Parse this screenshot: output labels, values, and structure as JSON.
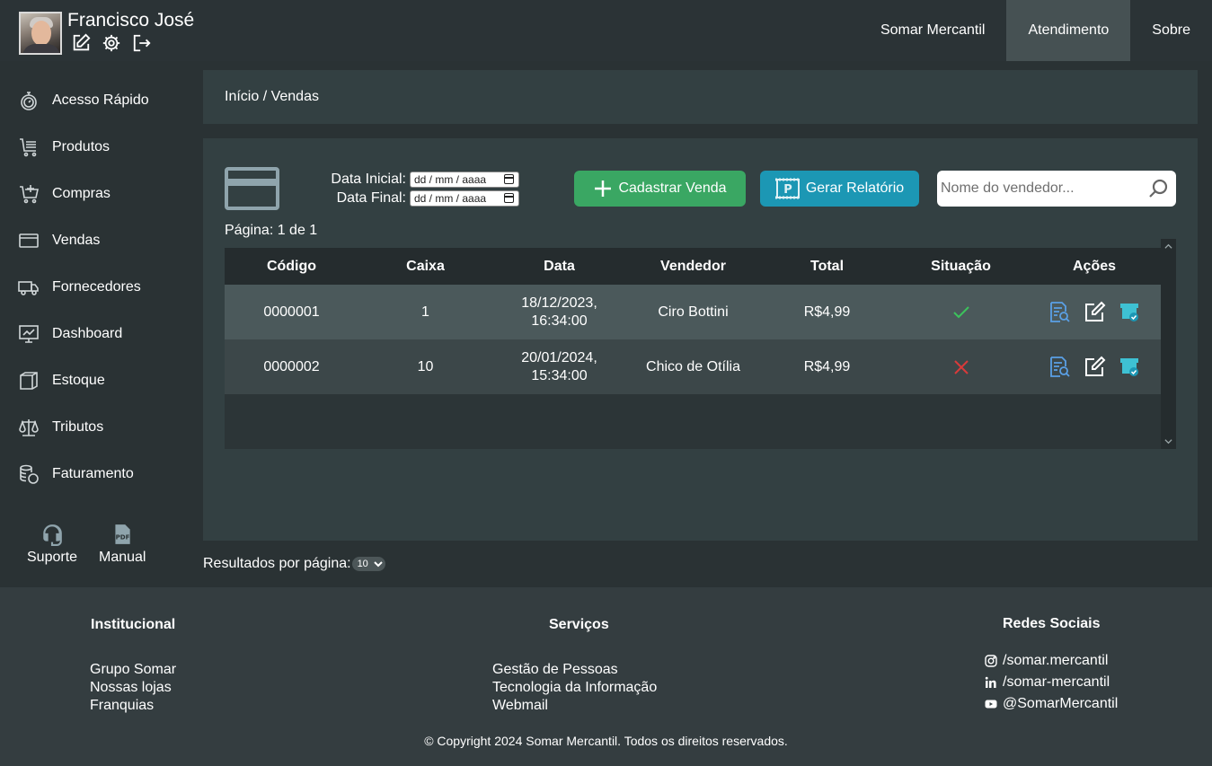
{
  "user": {
    "name": "Francisco José"
  },
  "nav": {
    "items": [
      "Somar Mercantil",
      "Atendimento",
      "Sobre"
    ],
    "active": "Atendimento"
  },
  "sidebar": {
    "items": [
      {
        "label": "Acesso Rápido",
        "icon": "stopwatch-icon"
      },
      {
        "label": "Produtos",
        "icon": "cart-list-icon"
      },
      {
        "label": "Compras",
        "icon": "cart-plus-icon"
      },
      {
        "label": "Vendas",
        "icon": "credit-card-icon"
      },
      {
        "label": "Fornecedores",
        "icon": "truck-icon"
      },
      {
        "label": "Dashboard",
        "icon": "monitor-icon"
      },
      {
        "label": "Estoque",
        "icon": "box-icon"
      },
      {
        "label": "Tributos",
        "icon": "scale-icon"
      },
      {
        "label": "Faturamento",
        "icon": "coins-icon"
      }
    ],
    "support_label": "Suporte",
    "manual_label": "Manual"
  },
  "breadcrumb": "Início / Vendas",
  "filters": {
    "start_label": "Data Inicial:",
    "end_label": "Data Final:",
    "date_placeholder": "dd / mm / aaaa"
  },
  "buttons": {
    "add_sale": "Cadastrar Venda",
    "report": "Gerar Relatório"
  },
  "search": {
    "placeholder": "Nome do vendedor..."
  },
  "pagination": {
    "info": "Página: 1 de 1",
    "per_page_label": "Resultados por página:",
    "per_page_value": "10"
  },
  "table": {
    "headers": [
      "Código",
      "Caixa",
      "Data",
      "Vendedor",
      "Total",
      "Situação",
      "Ações"
    ],
    "rows": [
      {
        "code": "0000001",
        "register": "1",
        "date_line1": "18/12/2023,",
        "date_line2": "16:34:00",
        "seller": "Ciro Bottini",
        "total": "R$4,99",
        "status": "ok"
      },
      {
        "code": "0000002",
        "register": "10",
        "date_line1": "20/01/2024,",
        "date_line2": "15:34:00",
        "seller": "Chico de Otília",
        "total": "R$4,99",
        "status": "cancelled"
      }
    ]
  },
  "footer": {
    "institutional": {
      "title": "Institucional",
      "links": [
        "Grupo Somar",
        "Nossas lojas",
        "Franquias"
      ]
    },
    "services": {
      "title": "Serviços",
      "links": [
        "Gestão de Pessoas",
        "Tecnologia da Informação",
        "Webmail"
      ]
    },
    "social": {
      "title": "Redes Sociais",
      "links": [
        "/somar.mercantil",
        "/somar-mercantil",
        "@SomarMercantil"
      ]
    },
    "copyright": "© Copyright 2024 Somar Mercantil. Todos os direitos reservados."
  },
  "colors": {
    "status_ok": "#3cc35c",
    "status_cancelled": "#d93a3a",
    "add_button": "#3aa763",
    "report_button": "#1c97b4"
  }
}
